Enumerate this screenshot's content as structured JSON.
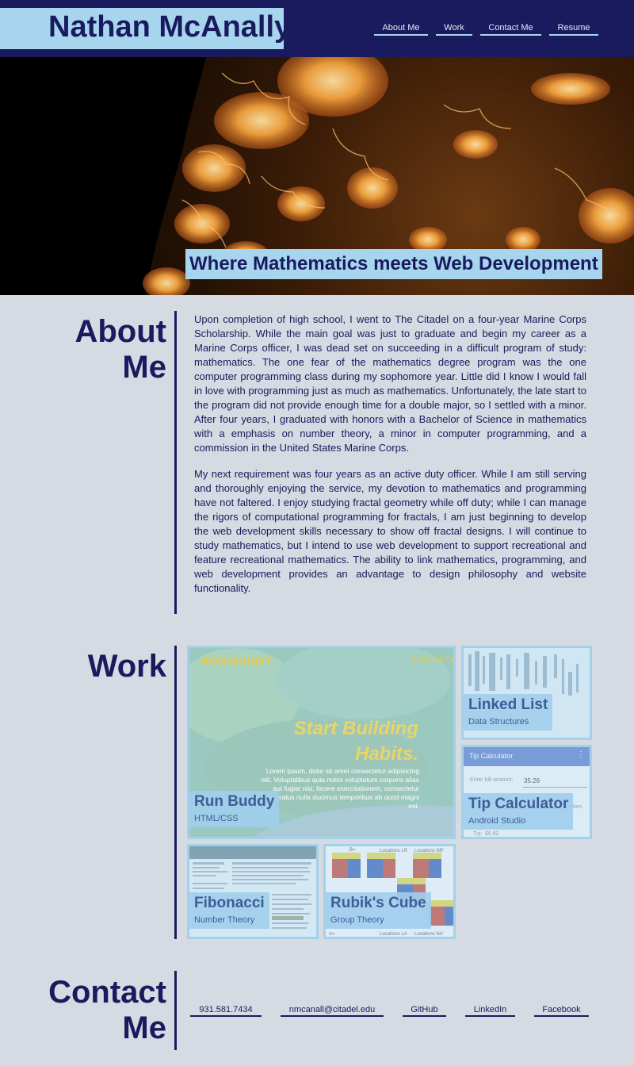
{
  "header": {
    "name": "Nathan McAnally",
    "nav": [
      "About Me",
      "Work",
      "Contact Me",
      "Resume"
    ]
  },
  "hero": {
    "tagline": "Where Mathematics meets Web Development"
  },
  "about": {
    "title_line1": "About",
    "title_line2": "Me",
    "paragraphs": [
      "Upon completion of high school, I went to The Citadel on a four-year Marine Corps Scholarship. While the main goal was just to graduate and begin my career as a Marine Corps officer, I was dead set on succeeding in a difficult program of study: mathematics. The one fear of the mathematics degree program was the one computer programming class during my sophomore year. Little did I know I would fall in love with programming just as much as mathematics. Unfortunately, the late start to the program did not provide enough time for a double major, so I settled with a minor. After four years, I graduated with honors with a Bachelor of Science in mathematics with a emphasis on number theory, a minor in computer programming, and a commission in the United States Marine Corps.",
      "My next requirement was four years as an active duty officer. While I am still serving and thoroughly enjoying the service, my devotion to mathematics and programming have not faltered. I enjoy studying fractal geometry while off duty; while I can manage the rigors of computational programming for fractals, I am just beginning to develop the web development skills necessary to show off fractal designs. I will continue to study mathematics, but I intend to use web development to support recreational and feature recreational mathematics. The ability to link mathematics, programming, and web development provides an advantage to design philosophy and website functionality."
    ]
  },
  "work": {
    "title": "Work",
    "projects": [
      {
        "title": "Run Buddy",
        "subtitle": "HTML/CSS",
        "preview": {
          "brand": "RUN BUDDY",
          "nav": "What We Do",
          "headline1": "Start Building",
          "headline2": "Habits.",
          "lorem": "Lorem ipsum, dolor sit amet consectetur adipisicing elit. Voluptatibus quia nobis voluptatum corporis alias aut fugiat nisi, facere exercitationem, consectetur autem natus nulla ducimus temporibus ab quod magni est."
        }
      },
      {
        "title": "Linked List",
        "subtitle": "Data Structures"
      },
      {
        "title": "Tip Calculator",
        "subtitle": "Android Studio",
        "preview": {
          "appbar": "Tip Calculator",
          "bill_label": "Enter bill amount:",
          "bill_value": "35.26",
          "tip_label": "Tip:",
          "tip_value": "$6.82",
          "custom": "ustom"
        }
      },
      {
        "title": "Fibonacci",
        "subtitle": "Number Theory"
      },
      {
        "title": "Rubik's Cube",
        "subtitle": "Group Theory",
        "preview": {
          "b_label": "B=",
          "lr": "Locations LR",
          "nr": "Locations NR'",
          "la": "Locations LA",
          "na": "Locations NA'",
          "a_label": "A="
        }
      }
    ]
  },
  "contact": {
    "title_line1": "Contact",
    "title_line2": "Me",
    "links": [
      "931.581.7434",
      "nmcanall@citadel.edu",
      "GitHub",
      "LinkedIn",
      "Facebook"
    ]
  },
  "colors": {
    "navy": "#1a1b5e",
    "light_blue": "#a7d5ee",
    "background": "#d5dae3",
    "fractal_orange": "#f3a23c"
  }
}
